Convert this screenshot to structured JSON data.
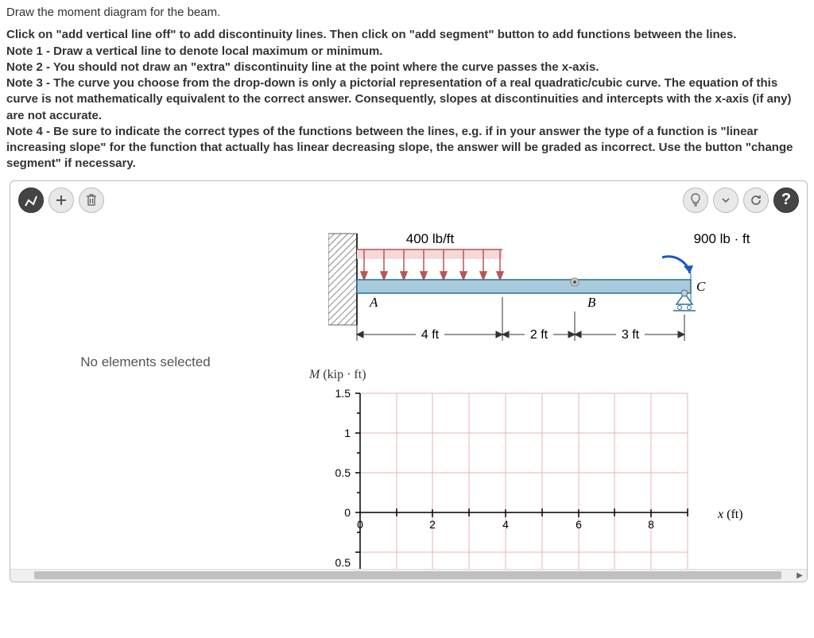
{
  "instructions": {
    "title": "Draw the moment diagram for the beam.",
    "p1": "Click on \"add vertical line off\" to add discontinuity lines. Then click on \"add segment\" button to add functions between the lines.",
    "note1": "Note 1 - Draw a vertical line to denote local maximum or minimum.",
    "note2": "Note 2 - You should not draw an \"extra\" discontinuity line at the point where the curve passes the x-axis.",
    "note3": "Note 3 - The curve you choose from the drop-down is only a pictorial representation of a real quadratic/cubic curve. The equation of this curve is not mathematically equivalent to the correct answer. Consequently, slopes at discontinuities and intercepts with the x-axis (if any) are not accurate.",
    "note4": "Note 4 - Be sure to indicate the correct types of the functions between the lines, e.g. if in your answer the type of a function is \"linear increasing slope\" for the function that actually has linear decreasing slope, the answer will be graded as incorrect. Use the button \"change segment\" if necessary."
  },
  "side": {
    "status": "No elements selected"
  },
  "beam": {
    "distributed_load": "400 lb/ft",
    "moment_load": "900 lb · ft",
    "point_a": "A",
    "point_b": "B",
    "point_c": "C",
    "dim1": "4 ft",
    "dim2": "2 ft",
    "dim3": "3 ft"
  },
  "chart_data": {
    "type": "line",
    "title": "",
    "ylabel": "M (kip · ft)",
    "xlabel": "x (ft)",
    "x_ticks": [
      0,
      2,
      4,
      6,
      8
    ],
    "y_ticks": [
      1.5,
      1.0,
      0.5,
      0.0,
      -0.5
    ],
    "ylim": [
      -0.5,
      1.5
    ],
    "xlim": [
      0,
      9
    ],
    "series": []
  }
}
